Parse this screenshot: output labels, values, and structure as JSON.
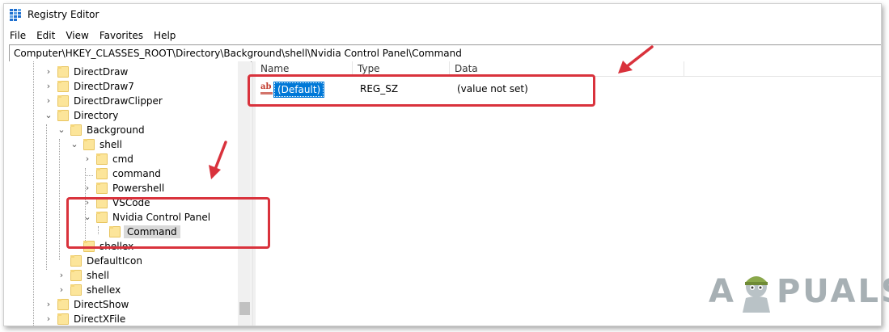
{
  "window": {
    "title": "Registry Editor"
  },
  "menu": [
    "File",
    "Edit",
    "View",
    "Favorites",
    "Help"
  ],
  "address": "Computer\\HKEY_CLASSES_ROOT\\Directory\\Background\\shell\\Nvidia Control Panel\\Command",
  "tree": [
    {
      "label": "DirectDraw",
      "expander": "collapsed"
    },
    {
      "label": "DirectDraw7",
      "expander": "collapsed"
    },
    {
      "label": "DirectDrawClipper",
      "expander": "collapsed"
    },
    {
      "label": "Directory",
      "expander": "expanded"
    },
    {
      "label": "Background",
      "expander": "expanded"
    },
    {
      "label": "shell",
      "expander": "expanded"
    },
    {
      "label": "cmd",
      "expander": "collapsed"
    },
    {
      "label": "command",
      "expander": "none"
    },
    {
      "label": "Powershell",
      "expander": "collapsed"
    },
    {
      "label": "VSCode",
      "expander": "collapsed"
    },
    {
      "label": "Nvidia Control Panel",
      "expander": "expanded"
    },
    {
      "label": "Command",
      "expander": "none",
      "selected": true
    },
    {
      "label": "shellex",
      "expander": "none"
    },
    {
      "label": "DefaultIcon",
      "expander": "none"
    },
    {
      "label": "shell",
      "expander": "collapsed"
    },
    {
      "label": "shellex",
      "expander": "collapsed"
    },
    {
      "label": "DirectShow",
      "expander": "collapsed"
    },
    {
      "label": "DirectXFile",
      "expander": "collapsed"
    }
  ],
  "columns": [
    "Name",
    "Type",
    "Data"
  ],
  "values": [
    {
      "name": "(Default)",
      "type": "REG_SZ",
      "data": "(value not set)",
      "icon": "string-value-icon"
    }
  ],
  "watermark": {
    "left": "A",
    "right": "PUALS"
  },
  "colors": {
    "highlight": "#d9323c",
    "selection": "#0078d7",
    "folder": "#fce59a"
  }
}
